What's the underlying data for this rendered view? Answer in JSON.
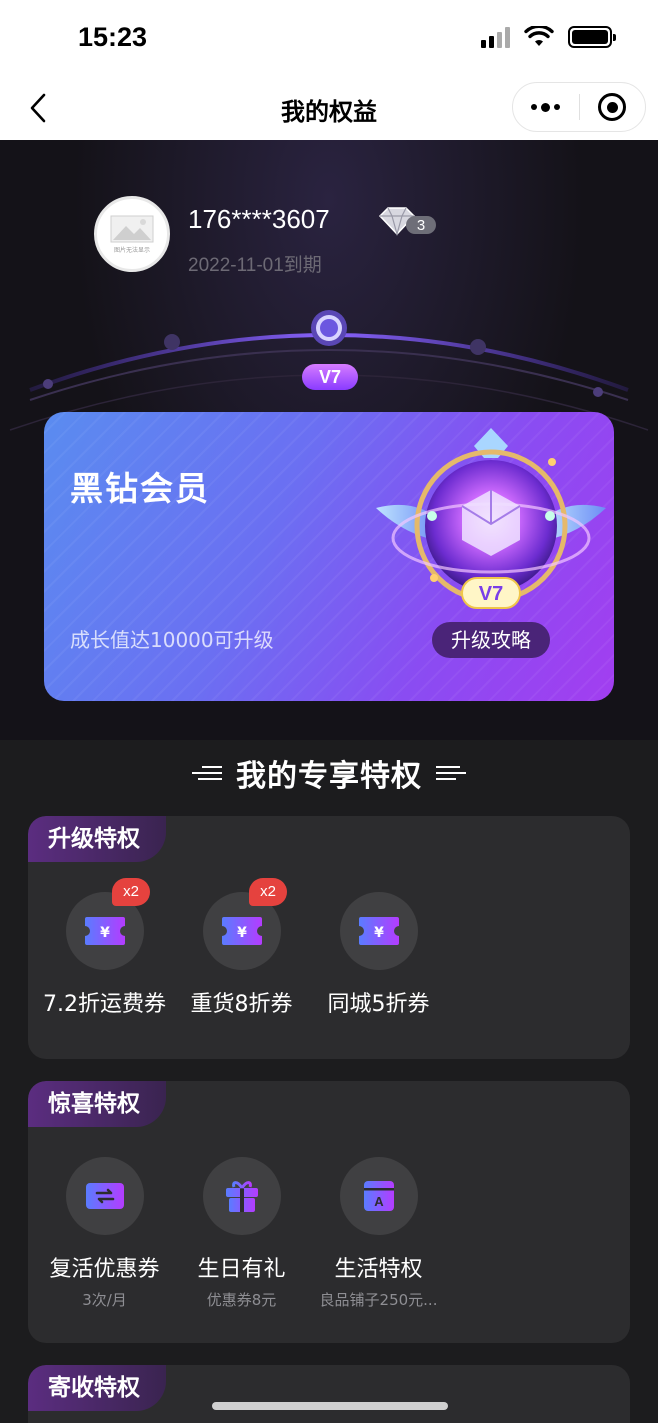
{
  "status_bar": {
    "time": "15:23"
  },
  "nav": {
    "title": "我的权益"
  },
  "profile": {
    "avatar_caption": "图片无法显示",
    "phone": "176****3607",
    "diamond_level": "3",
    "expire": "2022-11-01到期"
  },
  "level_marker": "V7",
  "member_card": {
    "title": "黑钻会员",
    "subtitle": "成长值达10000可升级",
    "badge_level": "V7",
    "upgrade_button": "升级攻略"
  },
  "section_title": "我的专享特权",
  "panels": [
    {
      "tag": "升级特权",
      "items": [
        {
          "label": "7.2折运费券",
          "badge": "x2",
          "icon": "coupon-icon"
        },
        {
          "label": "重货8折券",
          "badge": "x2",
          "icon": "coupon-icon"
        },
        {
          "label": "同城5折券",
          "icon": "coupon-icon"
        }
      ]
    },
    {
      "tag": "惊喜特权",
      "items": [
        {
          "label": "复活优惠券",
          "sub": "3次/月",
          "icon": "revive-coupon-icon"
        },
        {
          "label": "生日有礼",
          "sub": "优惠券8元",
          "icon": "gift-icon"
        },
        {
          "label": "生活特权",
          "sub": "良品铺子250元...",
          "icon": "shop-icon"
        }
      ]
    },
    {
      "tag": "寄收特权"
    }
  ],
  "colors": {
    "accent_purple": "#7c4dff",
    "badge_red": "#e5423e",
    "panel_bg": "#2c2c2e",
    "page_bg": "#1c1c1e"
  }
}
